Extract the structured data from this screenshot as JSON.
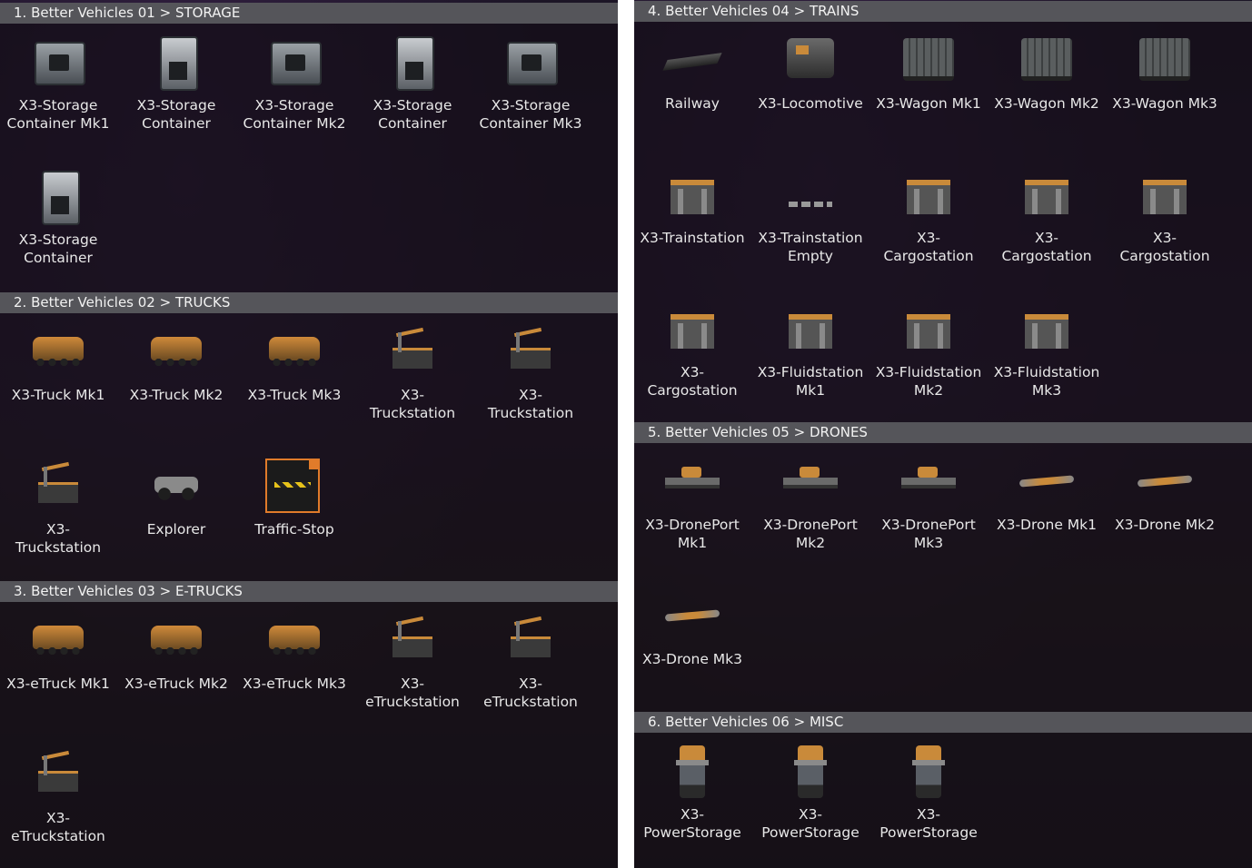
{
  "left": {
    "sections": [
      {
        "title": "1. Better Vehicles 01 > STORAGE",
        "items": [
          {
            "label": "X3-Storage\nContainer Mk1",
            "icon": "storage-container-icon"
          },
          {
            "label": "X3-Storage\nContainer",
            "icon": "storage-container-tall-icon"
          },
          {
            "label": "X3-Storage\nContainer Mk2",
            "icon": "storage-container-icon"
          },
          {
            "label": "X3-Storage\nContainer",
            "icon": "storage-container-tall-icon"
          },
          {
            "label": "X3-Storage\nContainer Mk3",
            "icon": "storage-container-icon"
          },
          {
            "label": "X3-Storage\nContainer",
            "icon": "storage-container-tall-icon"
          }
        ]
      },
      {
        "title": "2. Better Vehicles 02 > TRUCKS",
        "items": [
          {
            "label": "X3-Truck Mk1",
            "icon": "truck-icon"
          },
          {
            "label": "X3-Truck Mk2",
            "icon": "truck-icon"
          },
          {
            "label": "X3-Truck Mk3",
            "icon": "truck-icon"
          },
          {
            "label": "X3-\nTruckstation",
            "icon": "truckstation-icon"
          },
          {
            "label": "X3-\nTruckstation",
            "icon": "truckstation-icon"
          },
          {
            "label": "X3-\nTruckstation",
            "icon": "truckstation-icon"
          },
          {
            "label": "Explorer",
            "icon": "explorer-icon"
          },
          {
            "label": "Traffic-Stop",
            "icon": "traffic-stop-icon"
          }
        ]
      },
      {
        "title": "3. Better Vehicles 03 > E-TRUCKS",
        "items": [
          {
            "label": "X3-eTruck Mk1",
            "icon": "truck-icon"
          },
          {
            "label": "X3-eTruck Mk2",
            "icon": "truck-icon"
          },
          {
            "label": "X3-eTruck Mk3",
            "icon": "truck-icon"
          },
          {
            "label": "X3-\neTruckstation",
            "icon": "truckstation-icon"
          },
          {
            "label": "X3-\neTruckstation",
            "icon": "truckstation-icon"
          },
          {
            "label": "X3-\neTruckstation",
            "icon": "truckstation-icon"
          }
        ]
      }
    ]
  },
  "right": {
    "sections": [
      {
        "title": "4. Better Vehicles 04 > TRAINS",
        "items": [
          {
            "label": "Railway",
            "icon": "railway-icon"
          },
          {
            "label": "X3-Locomotive",
            "icon": "locomotive-icon"
          },
          {
            "label": "X3-Wagon Mk1",
            "icon": "wagon-icon"
          },
          {
            "label": "X3-Wagon Mk2",
            "icon": "wagon-icon"
          },
          {
            "label": "X3-Wagon Mk3",
            "icon": "wagon-icon"
          },
          {
            "label": "X3-Trainstation",
            "icon": "trainstation-icon"
          },
          {
            "label": "X3-Trainstation\nEmpty",
            "icon": "trainstation-empty-icon"
          },
          {
            "label": "X3-\nCargostation",
            "icon": "cargostation-icon"
          },
          {
            "label": "X3-\nCargostation",
            "icon": "cargostation-icon"
          },
          {
            "label": "X3-\nCargostation",
            "icon": "cargostation-icon"
          },
          {
            "label": "X3-\nCargostation",
            "icon": "cargostation-icon"
          },
          {
            "label": "X3-Fluidstation\nMk1",
            "icon": "fluidstation-icon"
          },
          {
            "label": "X3-Fluidstation\nMk2",
            "icon": "fluidstation-icon"
          },
          {
            "label": "X3-Fluidstation\nMk3",
            "icon": "fluidstation-icon"
          }
        ]
      },
      {
        "title": "5. Better Vehicles 05 > DRONES",
        "items": [
          {
            "label": "X3-DronePort\nMk1",
            "icon": "droneport-icon"
          },
          {
            "label": "X3-DronePort\nMk2",
            "icon": "droneport-icon"
          },
          {
            "label": "X3-DronePort\nMk3",
            "icon": "droneport-icon"
          },
          {
            "label": "X3-Drone Mk1",
            "icon": "drone-icon"
          },
          {
            "label": "X3-Drone Mk2",
            "icon": "drone-icon"
          },
          {
            "label": "X3-Drone Mk3",
            "icon": "drone-icon"
          }
        ]
      },
      {
        "title": "6. Better Vehicles 06 > MISC",
        "items": [
          {
            "label": "X3-\nPowerStorage",
            "icon": "power-storage-icon"
          },
          {
            "label": "X3-\nPowerStorage",
            "icon": "power-storage-icon"
          },
          {
            "label": "X3-\nPowerStorage",
            "icon": "power-storage-icon"
          }
        ]
      }
    ]
  },
  "colors": {
    "header_bg": "#55555a",
    "text": "#e8e8e8",
    "accent": "#e07b2a"
  }
}
